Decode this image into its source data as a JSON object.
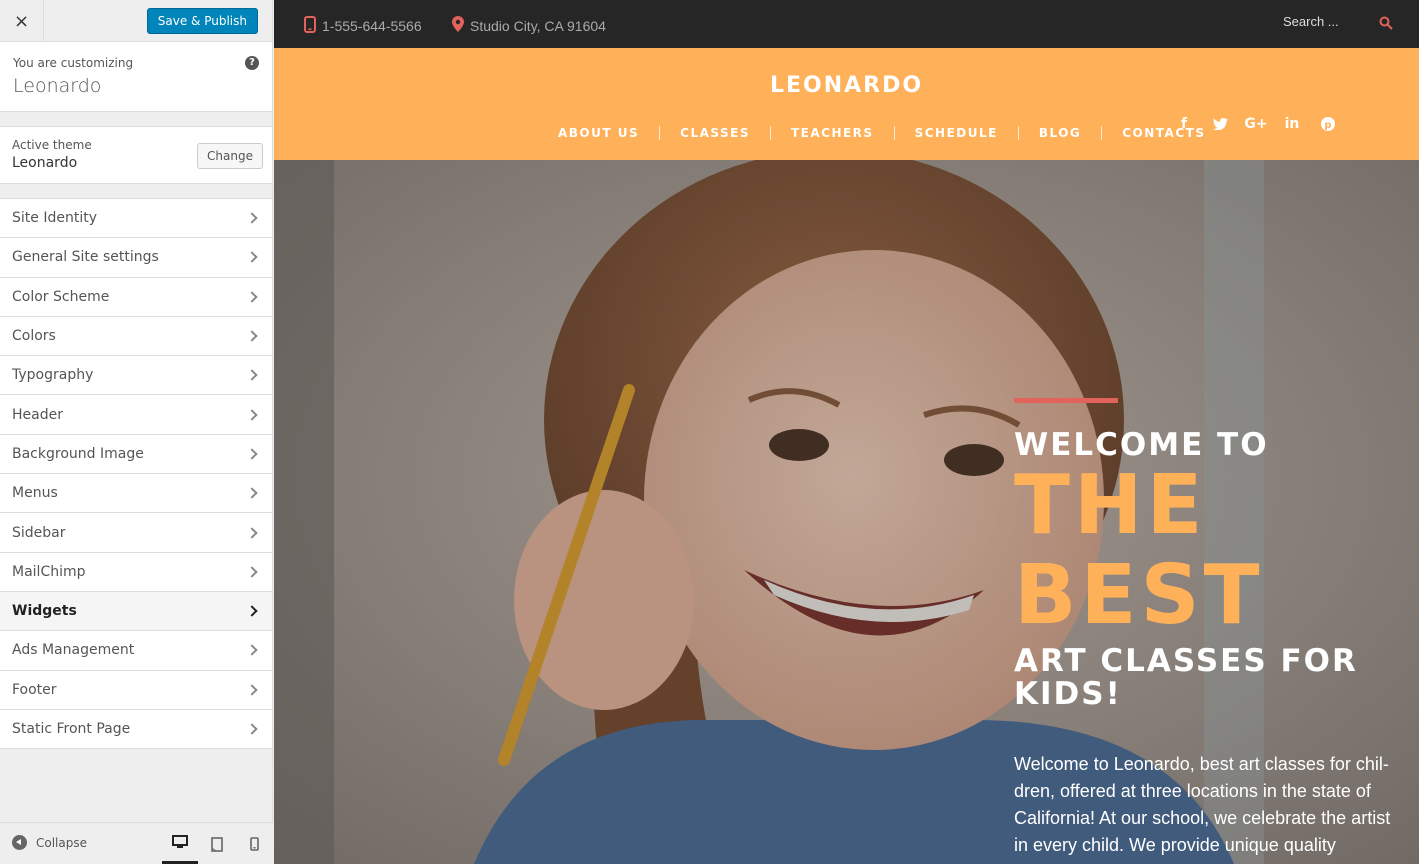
{
  "customizer": {
    "close_label": "×",
    "publish_label": "Save & Publish",
    "customizing_label": "You are customizing",
    "site_name": "Leonardo",
    "help_label": "?",
    "active_theme_label": "Active theme",
    "active_theme_name": "Leonardo",
    "change_label": "Change",
    "sections": [
      {
        "label": "Site Identity"
      },
      {
        "label": "General Site settings"
      },
      {
        "label": "Color Scheme"
      },
      {
        "label": "Colors"
      },
      {
        "label": "Typography"
      },
      {
        "label": "Header"
      },
      {
        "label": "Background Image"
      },
      {
        "label": "Menus"
      },
      {
        "label": "Sidebar"
      },
      {
        "label": "MailChimp"
      },
      {
        "label": "Widgets",
        "active": true
      },
      {
        "label": "Ads Management"
      },
      {
        "label": "Footer"
      },
      {
        "label": "Static Front Page"
      }
    ],
    "collapse_label": "Collapse",
    "devices": [
      "desktop-icon",
      "tablet-icon",
      "mobile-icon"
    ]
  },
  "site": {
    "phone": "1-555-644-5566",
    "address": "Studio City, CA 91604",
    "search_placeholder": "Search ...",
    "logo": "LEONARDO",
    "nav": [
      "ABOUT US",
      "CLASSES",
      "TEACHERS",
      "SCHEDULE",
      "BLOG",
      "CONTACTS"
    ],
    "social": [
      "f",
      "t",
      "G+",
      "in",
      "p"
    ],
    "hero": {
      "welcome": "WELCOME TO",
      "big_1": "THE",
      "big_2": "BEST",
      "subtitle": "ART CLASSES FOR KIDS!",
      "body": "Welcome to Leonardo, best art classes for chil-dren, offered at three locations in the state of California! At our school, we celebrate the artist in every child. We provide unique quality"
    }
  },
  "colors": {
    "accent_orange": "#ffb15a",
    "topbar_bg": "#262626",
    "accent_red": "#e2625c",
    "publish_blue": "#0085ba"
  }
}
